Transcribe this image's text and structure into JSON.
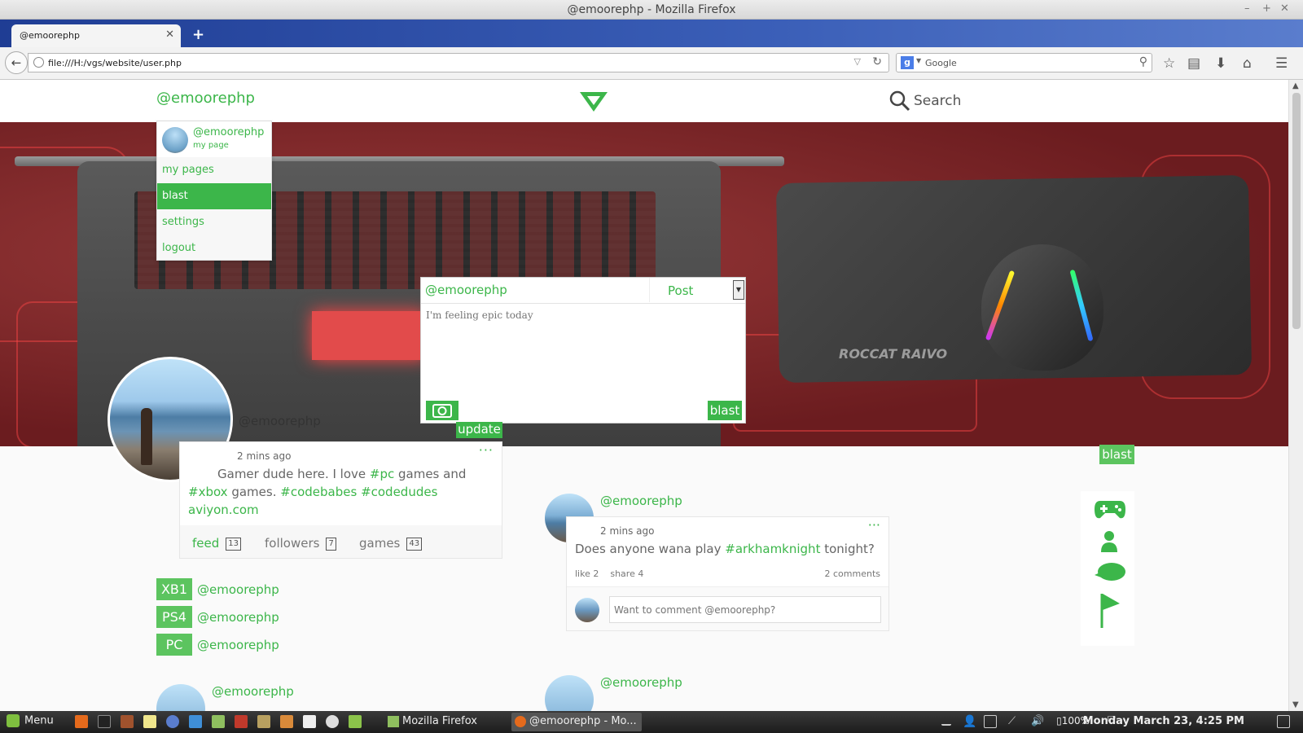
{
  "window": {
    "title": "@emoorephp - Mozilla Firefox"
  },
  "browser": {
    "tab_title": "@emoorephp",
    "url": "file:///H:/vgs/website/user.php",
    "search_placeholder": "Google"
  },
  "site": {
    "header_username": "@emoorephp",
    "search_label": "Search",
    "accent_color": "#3cb64a"
  },
  "dropdown": {
    "name": "@emoorephp",
    "sub": "my page",
    "items": [
      {
        "label": "my pages",
        "active": false
      },
      {
        "label": "blast",
        "active": true
      },
      {
        "label": "settings",
        "active": false
      },
      {
        "label": "logout",
        "active": false
      }
    ]
  },
  "postbox": {
    "username": "@emoorephp",
    "type_selected": "Post",
    "placeholder": "I'm feeling epic today",
    "camera_icon": "camera-icon",
    "submit_label": "blast"
  },
  "banner": {
    "brand_text": "ROCCAT RAIVO"
  },
  "profile": {
    "name": "@emoorephp",
    "update_label": "update",
    "bio_time": "2 mins ago",
    "bio_line1_a": "Gamer dude here. I love ",
    "bio_tag_pc": "#pc",
    "bio_line1_b": " games and",
    "bio_tag_xbox": "#xbox",
    "bio_line2_b": " games. ",
    "bio_tag_codebabes": "#codebabes",
    "bio_tag_codedudes": "#codedudes",
    "bio_link": "aviyon.com",
    "stats": {
      "feed_label": "feed",
      "feed_count": "13",
      "followers_label": "followers",
      "followers_count": "7",
      "games_label": "games",
      "games_count": "43"
    },
    "gamertags": [
      {
        "platform": "XB1",
        "handle": "@emoorephp"
      },
      {
        "platform": "PS4",
        "handle": "@emoorephp"
      },
      {
        "platform": "PC",
        "handle": "@emoorephp"
      }
    ]
  },
  "feed": {
    "post": {
      "username": "@emoorephp",
      "time": "2 mins ago",
      "text_a": "Does anyone wana play ",
      "text_tag": "#arkhamknight",
      "text_b": " tonight?",
      "likes": "like 2",
      "shares": "share 4",
      "comments": "2 comments",
      "comment_placeholder": "Want to comment @emoorephp?"
    },
    "next_usernames": [
      "@emoorephp",
      "@emoorephp"
    ]
  },
  "sidebar": {
    "blast_label": "blast",
    "icons": [
      "gamepad-icon",
      "user-icon",
      "chat-bubble-icon",
      "flag-icon"
    ]
  },
  "taskbar": {
    "menu_label": "Menu",
    "windows": [
      "Mozilla Firefox",
      "@emoorephp - Mo..."
    ],
    "battery": "100%",
    "clock": "Monday March 23,  4:25 PM"
  }
}
